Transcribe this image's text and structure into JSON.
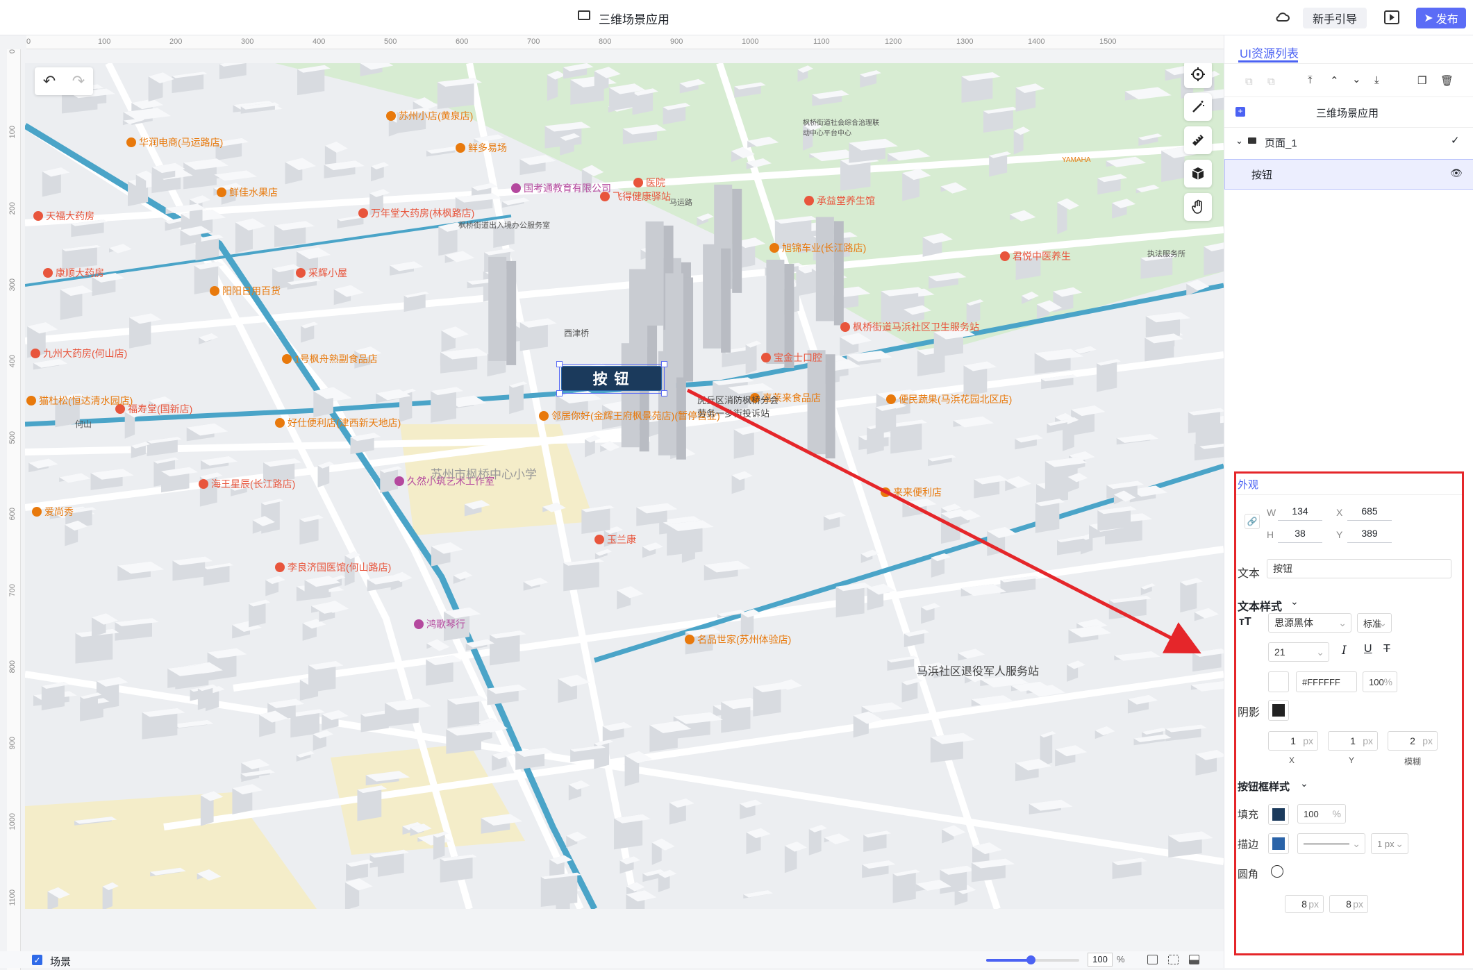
{
  "topbar": {
    "app_title": "三维场景应用",
    "guide_label": "新手引导",
    "publish_label": "发布"
  },
  "ruler_top": [
    "0",
    "100",
    "200",
    "300",
    "400",
    "500",
    "600",
    "700",
    "800",
    "900",
    "1000",
    "1100",
    "1200",
    "1300",
    "1400",
    "1500"
  ],
  "ruler_left": [
    "0",
    "100",
    "200",
    "300",
    "400",
    "500",
    "600",
    "700",
    "800",
    "900",
    "1000",
    "1100"
  ],
  "canvas": {
    "button_text": "按 钮",
    "map_labels": {
      "school": "苏州市枫桥中心小学",
      "service": "马浜社区退役军人服务站",
      "firestation": "虎丘区消防枫桥分会劳务一多街投诉站",
      "xijinqiao": "西津桥",
      "heshan": "何山",
      "maquan": "马运路",
      "tax": "执法服务所",
      "yamaha": "YAMAHA",
      "xinqiao": "枫桥街道出入境办公服务室",
      "yiliao": "枫桥街道社会综合治理联动中心平台中心"
    },
    "pois": [
      {
        "text": "九州大药房(何山店)",
        "c": "r"
      },
      {
        "text": "1号枫舟熟副食品店",
        "c": "o"
      },
      {
        "text": "福寿堂(国新店)",
        "c": "r"
      },
      {
        "text": "好仕便利店(津西新天地店)",
        "c": "o"
      },
      {
        "text": "邻居你好(金辉王府枫景苑店)(暂停营业)",
        "c": "o"
      },
      {
        "text": "久然小筑艺术工作室",
        "c": "p"
      },
      {
        "text": "海王星辰(长江路店)",
        "c": "r"
      },
      {
        "text": "玉兰康",
        "c": "r"
      },
      {
        "text": "李良济国医馆(何山路店)",
        "c": "r"
      },
      {
        "text": "鸿歌琴行",
        "c": "p"
      },
      {
        "text": "名品世家(苏州体验店)",
        "c": "o"
      },
      {
        "text": "来来便利店",
        "c": "o"
      },
      {
        "text": "便民蔬果(马浜花园北区店)",
        "c": "o"
      },
      {
        "text": "喜莱来食品店",
        "c": "o"
      },
      {
        "text": "宝金士口腔",
        "c": "r"
      },
      {
        "text": "枫桥街道马浜社区卫生服务站",
        "c": "r"
      },
      {
        "text": "君悦中医养生",
        "c": "r"
      },
      {
        "text": "旭锦车业(长江路店)",
        "c": "o"
      },
      {
        "text": "承益堂养生馆",
        "c": "r"
      },
      {
        "text": "医院",
        "c": "r"
      },
      {
        "text": "国考通教育有限公司",
        "c": "p"
      },
      {
        "text": "飞得健康驿站",
        "c": "r"
      },
      {
        "text": "万年堂大药房(林枫路店)",
        "c": "r"
      },
      {
        "text": "鲜佳水果店",
        "c": "o"
      },
      {
        "text": "天福大药房",
        "c": "r"
      },
      {
        "text": "康顺大药房",
        "c": "r"
      },
      {
        "text": "采辉小屋",
        "c": "r"
      },
      {
        "text": "阳阳日用百货",
        "c": "o"
      },
      {
        "text": "猫杜松(恒达清水园店)",
        "c": "o"
      },
      {
        "text": "爱尚秀",
        "c": "o"
      },
      {
        "text": "华润电商(马运路店)",
        "c": "o"
      },
      {
        "text": "鲜多易场",
        "c": "o"
      },
      {
        "text": "苏州小店(黄泉店)",
        "c": "o"
      }
    ]
  },
  "right_panel": {
    "tab_title": "UI资源列表",
    "tree": {
      "root": "三维场景应用",
      "page": "页面_1",
      "item": "按钮"
    },
    "appearance": {
      "tab": "外观",
      "w_label": "W",
      "w": "134",
      "h_label": "H",
      "h": "38",
      "x_label": "X",
      "x": "685",
      "y_label": "Y",
      "y": "389",
      "text_label": "文本",
      "text_value": "按钮",
      "text_style_title": "文本样式",
      "font_family": "思源黑体",
      "font_weight": "标准",
      "font_size": "21",
      "text_color": "#FFFFFF",
      "text_opacity": "100",
      "percent": "%",
      "shadow_label": "阴影",
      "shadow_x": "1",
      "shadow_y": "1",
      "shadow_blur": "2",
      "px": "px",
      "shadow_x_label": "X",
      "shadow_y_label": "Y",
      "shadow_blur_label": "模糊",
      "button_style_title": "按钮框样式",
      "fill_label": "填充",
      "fill_opacity": "100",
      "stroke_label": "描边",
      "stroke_width": "1",
      "radius_label": "圆角",
      "radius_a": "8",
      "radius_b": "8",
      "fill_color": "#1b3a5c",
      "stroke_color": "#2a63a8",
      "shadow_color": "#222222"
    }
  },
  "bottombar": {
    "scene_label": "场景",
    "zoom": "100",
    "zoom_unit": "%"
  },
  "colors": {
    "accent": "#5b6cf6",
    "highlight": "#e5262a"
  }
}
